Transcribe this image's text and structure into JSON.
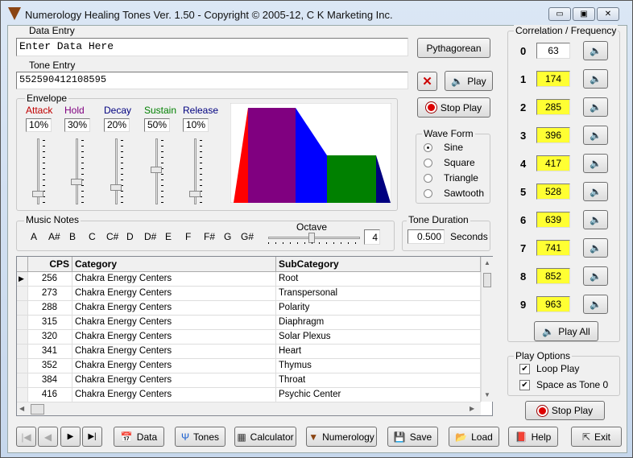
{
  "window": {
    "title": "Numerology Healing Tones Ver. 1.50 - Copyright © 2005-12, C K Marketing Inc.",
    "minimize": "▭",
    "maximize": "▣",
    "close": "✕"
  },
  "data_entry": {
    "label": "Data Entry",
    "value": "Enter Data Here",
    "method_button": "Pythagorean"
  },
  "tone_entry": {
    "label": "Tone Entry",
    "value": "552590412108595",
    "clear_icon": "✕",
    "play_label": "Play",
    "stop_label": "Stop Play"
  },
  "envelope": {
    "label": "Envelope",
    "params": [
      {
        "name": "Attack",
        "value": "10%",
        "color": "#c00000",
        "level": 10
      },
      {
        "name": "Hold",
        "value": "30%",
        "color": "#800080",
        "level": 30
      },
      {
        "name": "Decay",
        "value": "20%",
        "color": "#000080",
        "level": 20
      },
      {
        "name": "Sustain",
        "value": "50%",
        "color": "#008000",
        "level": 50
      },
      {
        "name": "Release",
        "value": "10%",
        "color": "#000080",
        "level": 10
      }
    ]
  },
  "wave_form": {
    "label": "Wave Form",
    "options": [
      "Sine",
      "Square",
      "Triangle",
      "Sawtooth"
    ],
    "selected": "Sine"
  },
  "music_notes": {
    "label": "Music Notes",
    "notes": [
      "A",
      "A#",
      "B",
      "C",
      "C#",
      "D",
      "D#",
      "E",
      "F",
      "F#",
      "G",
      "G#"
    ],
    "octave_label": "Octave",
    "octave": "4"
  },
  "tone_duration": {
    "label": "Tone Duration",
    "value": "0.500",
    "unit": "Seconds"
  },
  "table": {
    "columns": [
      "CPS",
      "Category",
      "SubCategory"
    ],
    "rows": [
      [
        "256",
        "Chakra Energy Centers",
        "Root"
      ],
      [
        "273",
        "Chakra Energy Centers",
        "Transpersonal"
      ],
      [
        "288",
        "Chakra Energy Centers",
        "Polarity"
      ],
      [
        "315",
        "Chakra Energy Centers",
        "Diaphragm"
      ],
      [
        "320",
        "Chakra Energy Centers",
        "Solar Plexus"
      ],
      [
        "341",
        "Chakra Energy Centers",
        "Heart"
      ],
      [
        "352",
        "Chakra Energy Centers",
        "Thymus"
      ],
      [
        "384",
        "Chakra Energy Centers",
        "Throat"
      ],
      [
        "416",
        "Chakra Energy Centers",
        "Psychic Center"
      ]
    ]
  },
  "correlation": {
    "label": "Correlation /  Frequency",
    "rows": [
      {
        "digit": "0",
        "freq": "63",
        "highlight": false
      },
      {
        "digit": "1",
        "freq": "174",
        "highlight": true
      },
      {
        "digit": "2",
        "freq": "285",
        "highlight": true
      },
      {
        "digit": "3",
        "freq": "396",
        "highlight": true
      },
      {
        "digit": "4",
        "freq": "417",
        "highlight": true
      },
      {
        "digit": "5",
        "freq": "528",
        "highlight": true
      },
      {
        "digit": "6",
        "freq": "639",
        "highlight": true
      },
      {
        "digit": "7",
        "freq": "741",
        "highlight": true
      },
      {
        "digit": "8",
        "freq": "852",
        "highlight": true
      },
      {
        "digit": "9",
        "freq": "963",
        "highlight": true
      }
    ],
    "play_all": "Play All",
    "highlight_color": "#ffff33"
  },
  "play_options": {
    "label": "Play Options",
    "loop_play": "Loop Play",
    "space_as_tone0": "Space as Tone 0",
    "stop_play": "Stop Play"
  },
  "toolbar": {
    "first": "|◀",
    "prev": "◀",
    "next": "▶",
    "last": "▶|",
    "data": "Data",
    "tones": "Tones",
    "calculator": "Calculator",
    "numerology": "Numerology",
    "save": "Save",
    "load": "Load",
    "help": "Help",
    "exit": "Exit"
  }
}
